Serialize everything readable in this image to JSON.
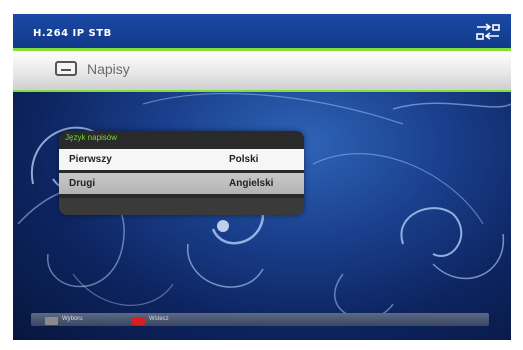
{
  "header": {
    "brand": "H.264 IP STB",
    "status_icon": "network-icon"
  },
  "page": {
    "title": "Napisy",
    "title_icon": "subtitles-icon"
  },
  "dialog": {
    "title": "Język napisów",
    "rows": [
      {
        "label": "Pierwszy",
        "value": "Polski",
        "selected": true
      },
      {
        "label": "Drugi",
        "value": "Angielski",
        "selected": false
      }
    ]
  },
  "footer": {
    "hints": [
      {
        "key": "grey",
        "label": "Wyboru"
      },
      {
        "key": "red",
        "label": "Wstecz"
      }
    ]
  },
  "colors": {
    "accent_green": "#7fe03a",
    "background_blue": "#1a3f8c",
    "red_key": "#d92020"
  }
}
